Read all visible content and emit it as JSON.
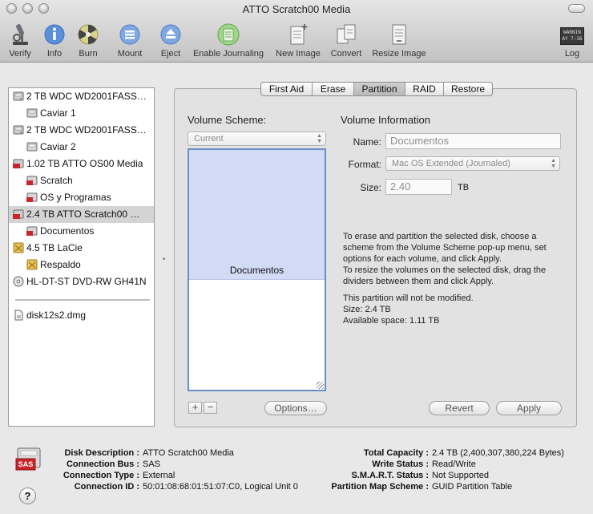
{
  "window": {
    "title": "ATTO Scratch00 Media"
  },
  "toolbar": {
    "items": [
      {
        "label": "Verify",
        "icon": "microscope-icon"
      },
      {
        "label": "Info",
        "icon": "info-icon"
      },
      {
        "label": "Burn",
        "icon": "burn-disc-icon"
      },
      {
        "label": "Mount",
        "icon": "mount-icon"
      },
      {
        "label": "Eject",
        "icon": "eject-icon"
      },
      {
        "label": "Enable Journaling",
        "icon": "journaling-icon"
      },
      {
        "label": "New Image",
        "icon": "new-image-icon"
      },
      {
        "label": "Convert",
        "icon": "convert-icon"
      },
      {
        "label": "Resize Image",
        "icon": "resize-image-icon"
      },
      {
        "label": "Log",
        "icon": "log-icon",
        "icon_text": "WARNIN\nAY 7:36"
      }
    ]
  },
  "sidebar": {
    "items": [
      {
        "label": "2 TB WDC WD2001FASS…",
        "kind": "disk"
      },
      {
        "label": "Caviar 1",
        "kind": "volume"
      },
      {
        "label": "2 TB WDC WD2001FASS…",
        "kind": "disk"
      },
      {
        "label": "Caviar 2",
        "kind": "volume"
      },
      {
        "label": "1.02 TB ATTO OS00 Media",
        "kind": "sas-disk"
      },
      {
        "label": "Scratch",
        "kind": "volume"
      },
      {
        "label": "OS y Programas",
        "kind": "volume"
      },
      {
        "label": "2.4 TB ATTO Scratch00 …",
        "kind": "sas-disk",
        "selected": true
      },
      {
        "label": "Documentos",
        "kind": "volume"
      },
      {
        "label": "4.5 TB LaCie",
        "kind": "external-disk"
      },
      {
        "label": "Respaldo",
        "kind": "external-volume"
      },
      {
        "label": "HL-DT-ST DVD-RW GH41N",
        "kind": "optical"
      },
      {
        "label": "disk12s2.dmg",
        "kind": "image"
      }
    ]
  },
  "tabs": [
    {
      "label": "First Aid"
    },
    {
      "label": "Erase"
    },
    {
      "label": "Partition",
      "active": true
    },
    {
      "label": "RAID"
    },
    {
      "label": "Restore"
    }
  ],
  "partition": {
    "volume_scheme_heading": "Volume Scheme:",
    "scheme_value": "Current",
    "partition_name": "Documentos",
    "options_label": "Options…",
    "add_label": "+",
    "remove_label": "−"
  },
  "volume_info": {
    "heading": "Volume Information",
    "name_label": "Name:",
    "name_value": "Documentos",
    "format_label": "Format:",
    "format_value": "Mac OS Extended (Journaled)",
    "size_label": "Size:",
    "size_value": "2.40",
    "size_unit": "TB",
    "instructions": [
      "To erase and partition the selected disk, choose a",
      "scheme from the Volume Scheme pop-up menu, set",
      "options for each volume, and click Apply.",
      "To resize the volumes on the selected disk, drag the",
      "dividers between them and click Apply."
    ],
    "status": [
      "This partition will not be modified.",
      "Size: 2.4 TB",
      "Available space: 1.11 TB"
    ],
    "revert_label": "Revert",
    "apply_label": "Apply"
  },
  "disk_info": {
    "icon_text": "SAS",
    "left": [
      {
        "label": "Disk Description :",
        "value": "ATTO Scratch00 Media"
      },
      {
        "label": "Connection Bus :",
        "value": "SAS"
      },
      {
        "label": "Connection Type :",
        "value": "External"
      },
      {
        "label": "Connection ID :",
        "value": "50:01:08:68:01:51:07:C0, Logical Unit 0"
      }
    ],
    "right": [
      {
        "label": "Total Capacity :",
        "value": "2.4 TB (2,400,307,380,224 Bytes)"
      },
      {
        "label": "Write Status :",
        "value": "Read/Write"
      },
      {
        "label": "S.M.A.R.T. Status :",
        "value": "Not Supported"
      },
      {
        "label": "Partition Map Scheme :",
        "value": "GUID Partition Table"
      }
    ]
  },
  "help": {
    "label": "?"
  }
}
